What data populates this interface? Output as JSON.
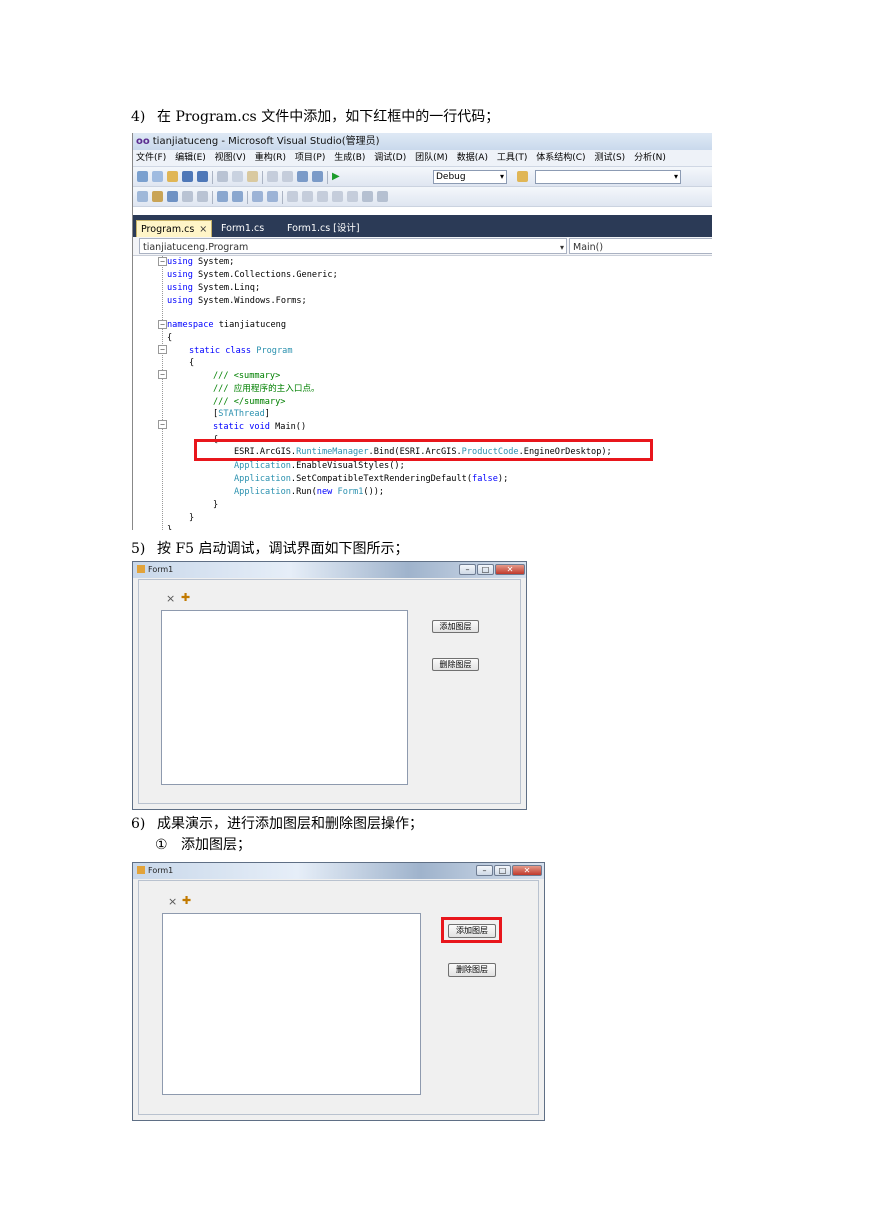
{
  "step4": {
    "num": "4)",
    "text": "在 Program.cs 文件中添加，如下红框中的一行代码；"
  },
  "step5": {
    "num": "5)",
    "text": "按 F5 启动调试，调试界面如下图所示；"
  },
  "step6": {
    "num": "6)",
    "text": "成果演示，进行添加图层和删除图层操作；"
  },
  "step6_1": {
    "num": "①",
    "text": "添加图层；"
  },
  "vs": {
    "logo": "oo",
    "title": "tianjiatuceng - Microsoft Visual Studio(管理员)",
    "menu": [
      "文件(F)",
      "编辑(E)",
      "视图(V)",
      "重构(R)",
      "项目(P)",
      "生成(B)",
      "调试(D)",
      "团队(M)",
      "数据(A)",
      "工具(T)",
      "体系结构(C)",
      "测试(S)",
      "分析(N)"
    ],
    "config": "Debug",
    "tabs": [
      {
        "label": "Program.cs",
        "close": "×"
      },
      {
        "label": "Form1.cs"
      },
      {
        "label": "Form1.cs [设计]"
      }
    ],
    "nav_left": "tianjiatuceng.Program",
    "nav_right": "Main()",
    "code": {
      "l1a": "using",
      "l1b": " System;",
      "l2a": "using",
      "l2b": " System.Collections.Generic;",
      "l3a": "using",
      "l3b": " System.Linq;",
      "l4a": "using",
      "l4b": " System.Windows.Forms;",
      "l5a": "namespace",
      "l5b": " tianjiatuceng",
      "l6": "{",
      "l7a": "static class",
      "l7b": "Program",
      "l8": "{",
      "l9": "/// <summary>",
      "l10": "/// 应用程序的主入口点。",
      "l11": "/// </summary>",
      "l12a": "[",
      "l12b": "STAThread",
      "l12c": "]",
      "l13a": "static void",
      "l13b": " Main()",
      "l14": "{",
      "l15a": "ESRI.ArcGIS.",
      "l15b": "RuntimeManager",
      "l15c": ".Bind(ESRI.ArcGIS.",
      "l15d": "ProductCode",
      "l15e": ".EngineOrDesktop);",
      "l16a": "Application",
      "l16b": ".EnableVisualStyles();",
      "l17a": "Application",
      "l17b": ".SetCompatibleTextRenderingDefault(",
      "l17c": "false",
      "l17d": ");",
      "l18a": "Application",
      "l18b": ".Run(",
      "l18c": "new",
      "l18d": "Form1",
      "l18e": "());",
      "l19": "}",
      "l20": "}",
      "l21": "}"
    }
  },
  "form": {
    "title": "Form1",
    "min": "–",
    "max": "□",
    "close": "✕",
    "tool_close": "×",
    "tool_add": "✚",
    "add_button": "添加图层",
    "delete_button": "删除图层"
  },
  "colors": {
    "highlight": "#e8161c"
  }
}
